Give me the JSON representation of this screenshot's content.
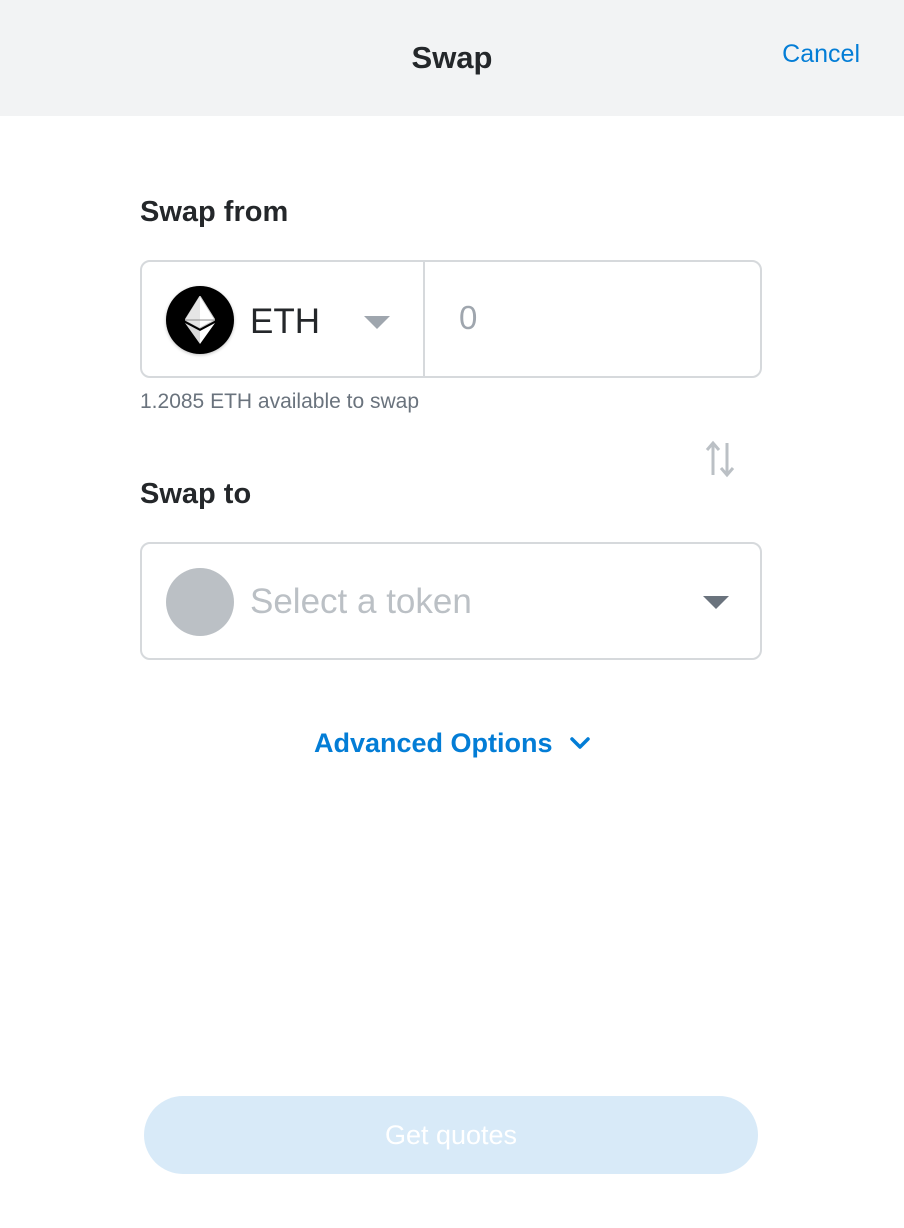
{
  "header": {
    "title": "Swap",
    "cancel_label": "Cancel"
  },
  "swap_from": {
    "label": "Swap from",
    "token_symbol": "ETH",
    "token_icon": "ethereum-icon",
    "amount_placeholder": "0",
    "amount_value": "",
    "balance_text": "1.2085 ETH available to swap"
  },
  "switch_icon": "swap-arrows-icon",
  "swap_to": {
    "label": "Swap to",
    "placeholder": "Select a token"
  },
  "advanced_options": {
    "label": "Advanced Options",
    "icon": "chevron-down-icon"
  },
  "get_quotes": {
    "label": "Get quotes",
    "disabled": true
  },
  "colors": {
    "accent": "#037dd6",
    "button_disabled_bg": "#d8eaf8",
    "header_bg": "#f2f3f4",
    "border": "#d6d9dc"
  }
}
